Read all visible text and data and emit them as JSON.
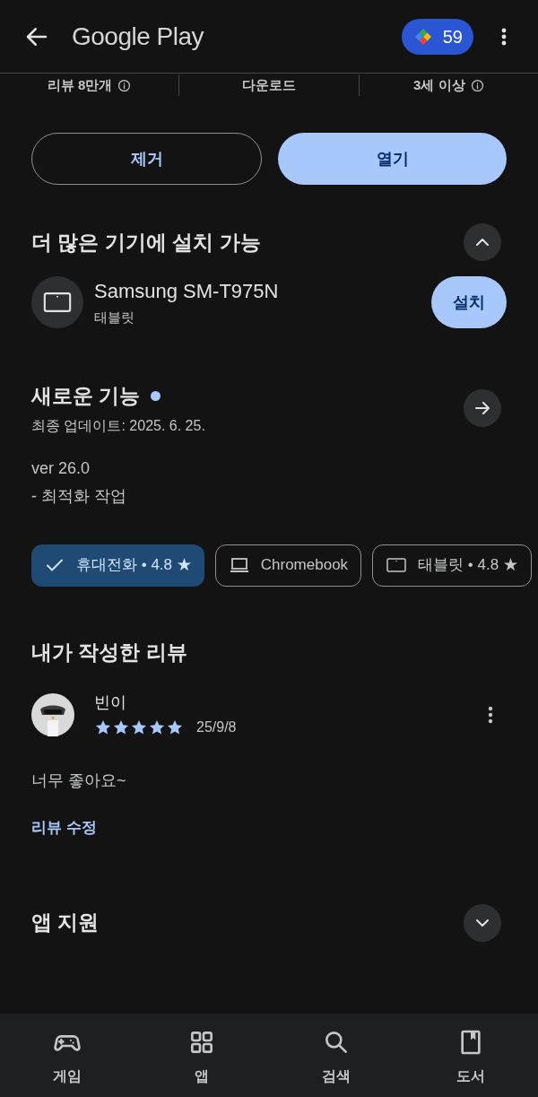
{
  "top_bar": {
    "title": "Google Play",
    "points": "59"
  },
  "stats": [
    {
      "label": "리뷰 8만개",
      "info": true
    },
    {
      "label": "다운로드",
      "info": false
    },
    {
      "label": "3세 이상",
      "info": true
    }
  ],
  "actions": [
    {
      "label": "제거",
      "kind": "outline"
    },
    {
      "label": "열기",
      "kind": "filled"
    }
  ],
  "devices_section": {
    "title": "더 많은 기기에 설치 가능",
    "expanded": true,
    "device": {
      "name": "Samsung SM-T975N",
      "type": "태블릿",
      "button": "설치"
    }
  },
  "whats_new": {
    "title": "새로운 기능",
    "unread": true,
    "updated": "최종 업데이트: 2025. 6. 25.",
    "notes": [
      "ver 26.0",
      "- 최적화 작업"
    ]
  },
  "device_chips": [
    {
      "label": "휴대전화 • 4.8 ★",
      "selected": true
    },
    {
      "label": "Chromebook",
      "kind": "laptop",
      "selected": false
    },
    {
      "label": "태블릿 • 4.8 ★",
      "kind": "tablet",
      "selected": false
    }
  ],
  "my_review": {
    "title": "내가 작성한 리뷰",
    "author": "빈이",
    "stars": 5,
    "date": "25/9/8",
    "text": "너무 좋아요~",
    "edit_link": "리뷰 수정"
  },
  "support_section": {
    "title": "앱 지원",
    "expanded": false
  },
  "bottom_nav": [
    {
      "label": "게임",
      "kind": "games"
    },
    {
      "label": "앱",
      "kind": "apps"
    },
    {
      "label": "검색",
      "kind": "search"
    },
    {
      "label": "도서",
      "kind": "books"
    }
  ]
}
